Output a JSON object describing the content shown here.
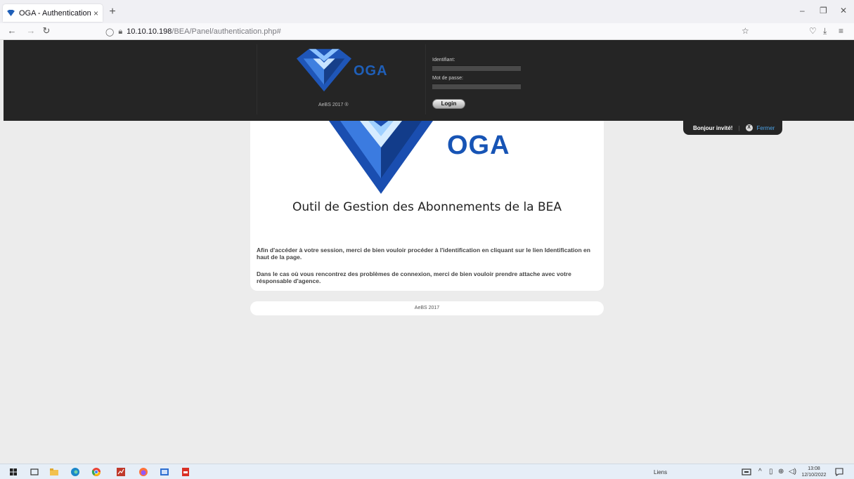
{
  "browser": {
    "tab_title": "OGA - Authentication",
    "tab_close": "×",
    "new_tab": "+",
    "url_host": "10.10.10.198",
    "url_path": "/BEA/Panel/authentication.php#",
    "window_minimize": "–",
    "window_restore": "❐",
    "window_close": "✕"
  },
  "login_panel": {
    "logo_text": "OGA",
    "copyright": "AeBS 2017 ®",
    "username_label": "Identifiant:",
    "username_value": "",
    "password_label": "Mot de passe:",
    "password_value": "",
    "login_button": "Login"
  },
  "toggle": {
    "greeting": "Bonjour invité!",
    "separator": "|",
    "close_icon": "X",
    "close_label": "Fermer"
  },
  "main": {
    "logo_text": "OGA",
    "heading": "Outil de Gestion des Abonnements de la BEA",
    "paragraph1": "Afin d'accéder à votre session, merci de bien vouloir procéder à l'identification en cliquant sur le lien Identification en haut de la page.",
    "paragraph2": "Dans le cas où vous rencontrez des problèmes de connexion, merci de bien vouloir prendre attache avec votre résponsable d'agence."
  },
  "footer": {
    "text": "AeBS 2017"
  },
  "taskbar": {
    "links_label": "Liens",
    "time": "13:08",
    "date": "12/10/2022"
  },
  "colors": {
    "panel_bg": "#252525",
    "brand_blue": "#1754b5",
    "link_blue": "#4ba3e8",
    "page_bg": "#ececec"
  }
}
